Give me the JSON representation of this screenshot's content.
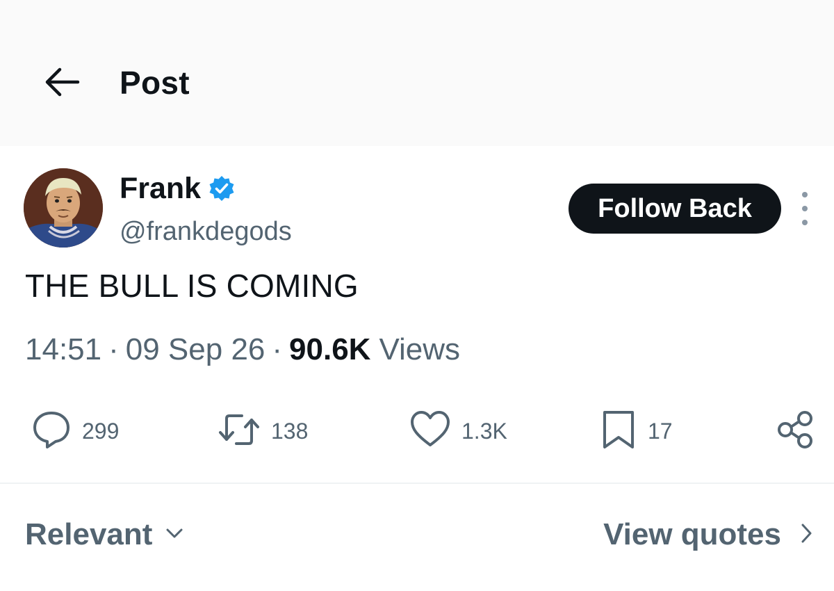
{
  "header": {
    "back_icon": "arrow-left-icon",
    "title": "Post"
  },
  "author": {
    "name": "Frank",
    "handle": "@frankdegods",
    "verified_icon": "verified-badge-icon",
    "verified_color": "#1d9bf0",
    "follow_label": "Follow Back",
    "more_icon": "more-vertical-icon"
  },
  "post": {
    "text": "THE BULL IS COMING",
    "time": "14:51",
    "date": "09 Sep 26",
    "separator": "·",
    "views_count": "90.6K",
    "views_label": "Views"
  },
  "actions": {
    "replies": {
      "icon": "reply-icon",
      "count": "299"
    },
    "reposts": {
      "icon": "repost-icon",
      "count": "138"
    },
    "likes": {
      "icon": "heart-icon",
      "count": "1.3K"
    },
    "bookmarks": {
      "icon": "bookmark-icon",
      "count": "17"
    },
    "share": {
      "icon": "share-icon"
    }
  },
  "replies_bar": {
    "sort_label": "Relevant",
    "sort_icon": "chevron-down-icon",
    "quotes_label": "View quotes",
    "quotes_icon": "chevron-right-icon"
  },
  "colors": {
    "text_primary": "#0f1419",
    "text_secondary": "#536471",
    "follow_bg": "#0f1419",
    "header_bg": "#fafafa"
  }
}
